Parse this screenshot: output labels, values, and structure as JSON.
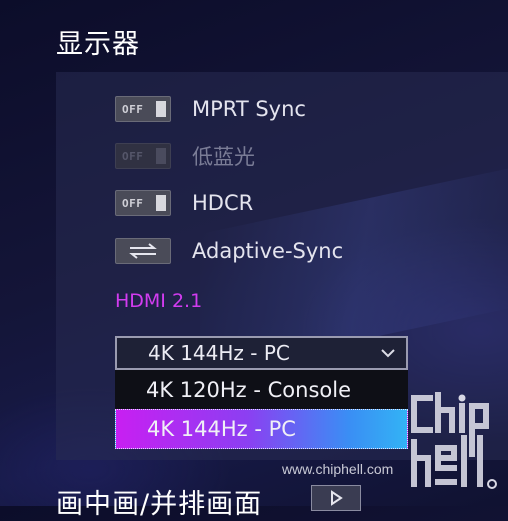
{
  "section": {
    "title": "显示器"
  },
  "settings": [
    {
      "label": "MPRT Sync",
      "control": "toggle",
      "state": "OFF",
      "disabled": false
    },
    {
      "label": "低蓝光",
      "control": "toggle",
      "state": "OFF",
      "disabled": true
    },
    {
      "label": "HDCR",
      "control": "toggle",
      "state": "OFF",
      "disabled": false
    },
    {
      "label": "Adaptive-Sync",
      "control": "cycle-icon",
      "disabled": false
    }
  ],
  "hdmi": {
    "heading": "HDMI 2.1",
    "selected_value": "4K 144Hz - PC",
    "options": [
      "4K 120Hz - Console",
      "4K 144Hz - PC"
    ],
    "highlighted_index": 1
  },
  "watermark": {
    "site": "www.chiphell.com"
  },
  "next_section": {
    "title": "画中画/并排画面"
  },
  "colors": {
    "accent": "#d23cf0",
    "highlight_start": "#c81ff2",
    "highlight_end": "#33b3f5"
  }
}
